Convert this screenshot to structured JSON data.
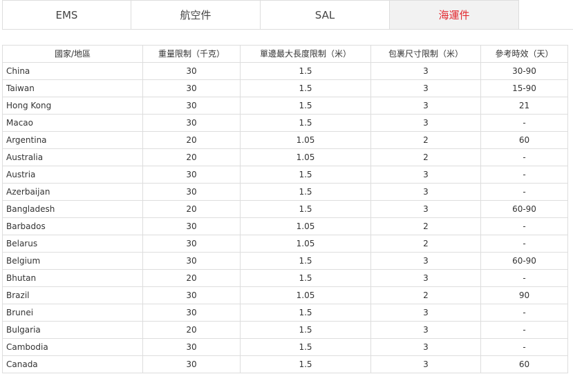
{
  "tabs": [
    {
      "label": "EMS",
      "active": false
    },
    {
      "label": "航空件",
      "active": false
    },
    {
      "label": "SAL",
      "active": false
    },
    {
      "label": "海運件",
      "active": true
    }
  ],
  "accent_color": "#e2282e",
  "table": {
    "headers": [
      "國家/地區",
      "重量限制（千克）",
      "單邊最大長度限制（米）",
      "包裹尺寸限制（米）",
      "參考時效（天）"
    ],
    "rows": [
      [
        "China",
        "30",
        "1.5",
        "3",
        "30-90"
      ],
      [
        "Taiwan",
        "30",
        "1.5",
        "3",
        "15-90"
      ],
      [
        "Hong Kong",
        "30",
        "1.5",
        "3",
        "21"
      ],
      [
        "Macao",
        "30",
        "1.5",
        "3",
        "-"
      ],
      [
        "Argentina",
        "20",
        "1.05",
        "2",
        "60"
      ],
      [
        "Australia",
        "20",
        "1.05",
        "2",
        "-"
      ],
      [
        "Austria",
        "30",
        "1.5",
        "3",
        "-"
      ],
      [
        "Azerbaijan",
        "30",
        "1.5",
        "3",
        "-"
      ],
      [
        "Bangladesh",
        "20",
        "1.5",
        "3",
        "60-90"
      ],
      [
        "Barbados",
        "30",
        "1.05",
        "2",
        "-"
      ],
      [
        "Belarus",
        "30",
        "1.05",
        "2",
        "-"
      ],
      [
        "Belgium",
        "30",
        "1.5",
        "3",
        "60-90"
      ],
      [
        "Bhutan",
        "20",
        "1.5",
        "3",
        "-"
      ],
      [
        "Brazil",
        "30",
        "1.05",
        "2",
        "90"
      ],
      [
        "Brunei",
        "30",
        "1.5",
        "3",
        "-"
      ],
      [
        "Bulgaria",
        "20",
        "1.5",
        "3",
        "-"
      ],
      [
        "Cambodia",
        "30",
        "1.5",
        "3",
        "-"
      ],
      [
        "Canada",
        "30",
        "1.5",
        "3",
        "60"
      ]
    ]
  }
}
